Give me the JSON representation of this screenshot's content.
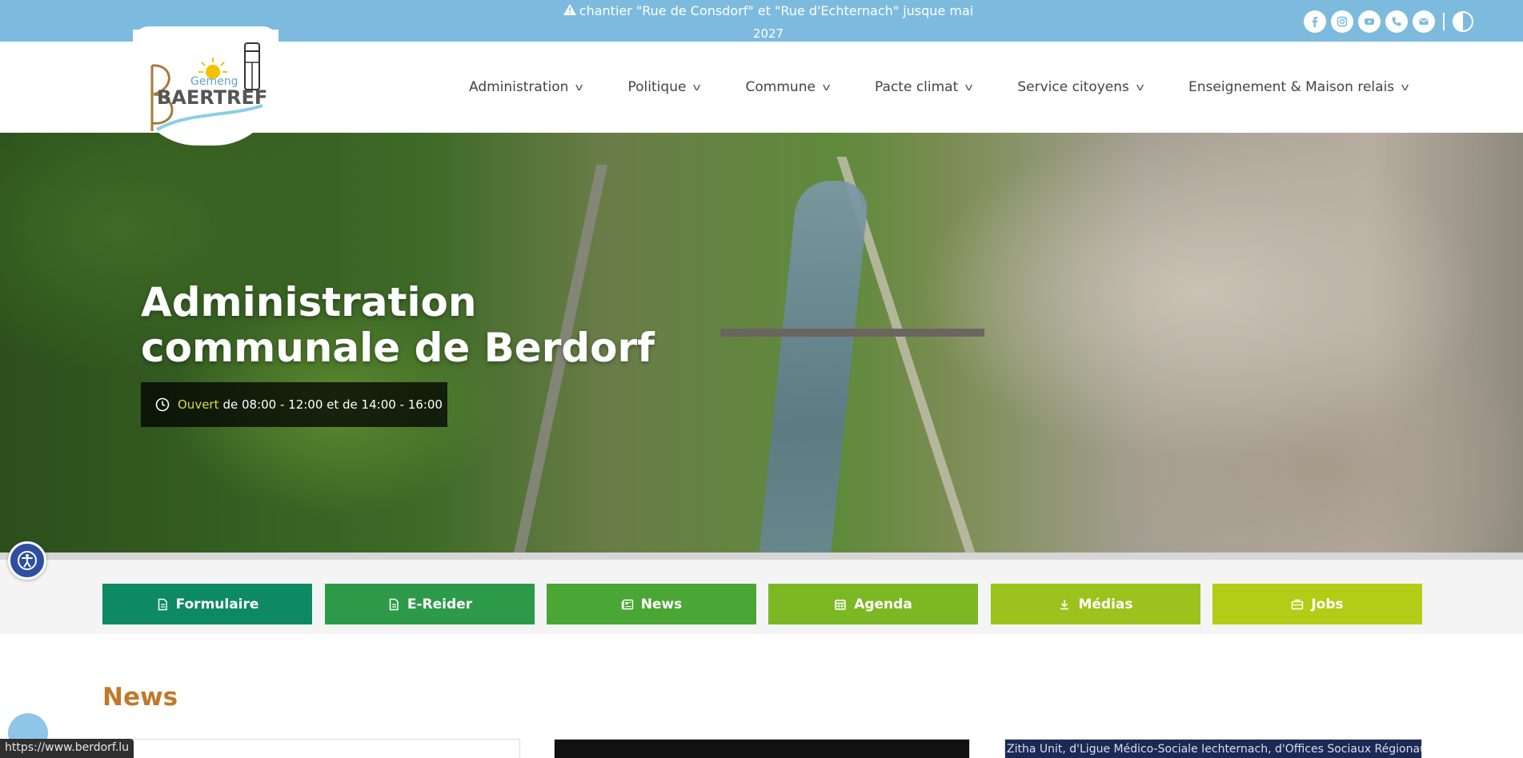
{
  "alert": {
    "icon": "warning-icon",
    "text_line1": "chantier \"Rue de Consdorf\" et \"Rue d'Echternach\" jusque mai",
    "text_line2": "2027"
  },
  "socials": [
    {
      "name": "facebook-icon"
    },
    {
      "name": "instagram-icon"
    },
    {
      "name": "youtube-icon"
    },
    {
      "name": "phone-icon"
    },
    {
      "name": "mail-icon"
    },
    {
      "name": "contrast-toggle-icon"
    }
  ],
  "logo": {
    "line1": "Gemeng",
    "line2": "BAERTREF"
  },
  "nav": {
    "items": [
      {
        "label": "Administration"
      },
      {
        "label": "Politique"
      },
      {
        "label": "Commune"
      },
      {
        "label": "Pacte climat"
      },
      {
        "label": "Service citoyens"
      },
      {
        "label": "Enseignement & Maison relais"
      }
    ]
  },
  "hero": {
    "title_line1": "Administration",
    "title_line2": "communale de Berdorf",
    "hours_status": "Ouvert",
    "hours_text": "de 08:00 - 12:00 et de 14:00 - 16:00"
  },
  "quick_links": [
    {
      "label": "Formulaire",
      "icon": "document-icon",
      "color": "#0d8a62"
    },
    {
      "label": "E-Reider",
      "icon": "document-icon",
      "color": "#2d9a4a"
    },
    {
      "label": "News",
      "icon": "newspaper-icon",
      "color": "#4aa635"
    },
    {
      "label": "Agenda",
      "icon": "calendar-icon",
      "color": "#7cb824"
    },
    {
      "label": "Médias",
      "icon": "download-icon",
      "color": "#9cc21d"
    },
    {
      "label": "Jobs",
      "icon": "briefcase-icon",
      "color": "#b3cc15"
    }
  ],
  "news": {
    "heading": "News",
    "card3_caption": "Zitha Unit, d'Ligue Médico-Sociale Iechternach, d'Offices Sociaux Régionaux"
  },
  "status_bar": {
    "url": "https://www.berdorf.lu"
  },
  "colors": {
    "topbar": "#7dbbde",
    "news_heading": "#c0792b",
    "hours_open": "#d7de3a"
  }
}
